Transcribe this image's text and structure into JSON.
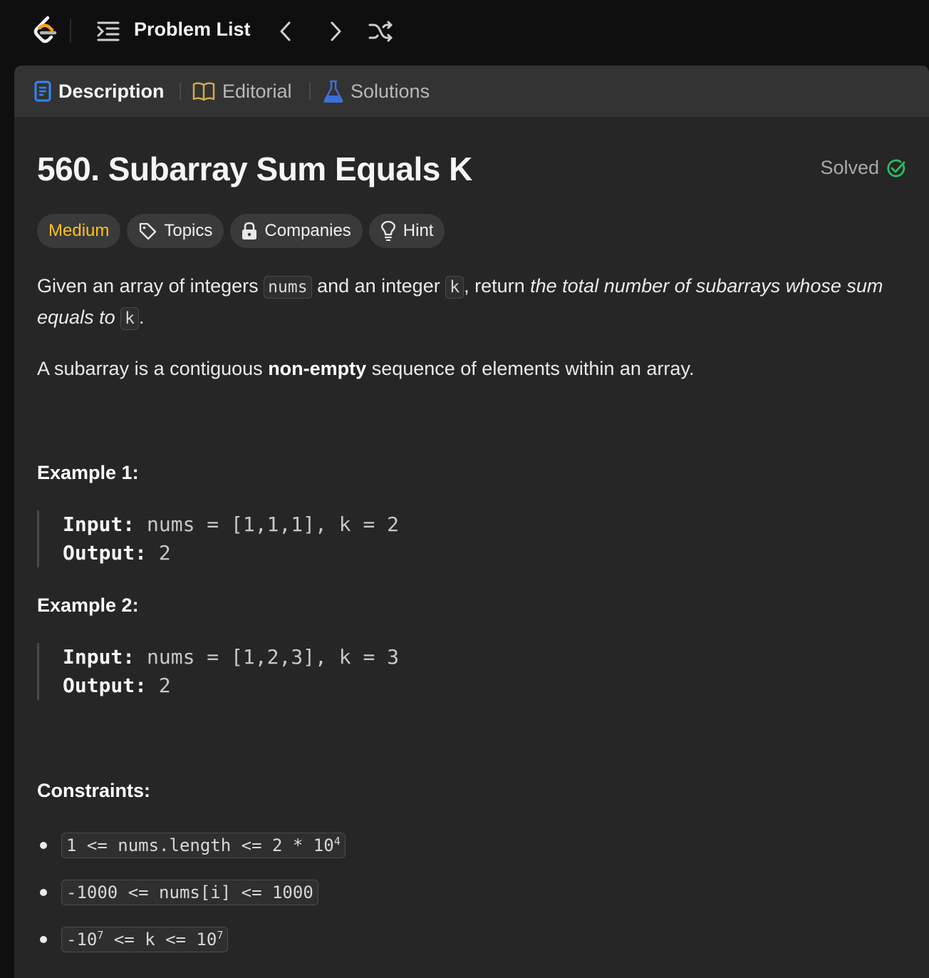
{
  "nav": {
    "problem_list_label": "Problem List"
  },
  "tabs": {
    "description": "Description",
    "editorial": "Editorial",
    "solutions": "Solutions"
  },
  "problem": {
    "title": "560. Subarray Sum Equals K",
    "status": "Solved",
    "difficulty": "Medium",
    "chips": {
      "topics": "Topics",
      "companies": "Companies",
      "hint": "Hint"
    },
    "description": {
      "p1_a": "Given an array of integers ",
      "p1_code1": "nums",
      "p1_b": " and an integer ",
      "p1_code2": "k",
      "p1_c": ", return ",
      "p1_em": "the total number of subarrays whose sum equals to",
      "p1_d": " ",
      "p1_code3": "k",
      "p1_e": ".",
      "p2_a": "A subarray is a contiguous ",
      "p2_bold": "non-empty",
      "p2_b": " sequence of elements within an array."
    },
    "examples": [
      {
        "heading": "Example 1:",
        "input_label": "Input:",
        "input_value": " nums = [1,1,1], k = 2",
        "output_label": "Output:",
        "output_value": " 2"
      },
      {
        "heading": "Example 2:",
        "input_label": "Input:",
        "input_value": " nums = [1,2,3], k = 3",
        "output_label": "Output:",
        "output_value": " 2"
      }
    ],
    "constraints_heading": "Constraints:",
    "constraints": [
      {
        "text": "1 <= nums.length <= 2 * 10",
        "sup": "4",
        "tail": ""
      },
      {
        "text": "-1000 <= nums[i] <= 1000",
        "sup": "",
        "tail": ""
      },
      {
        "text": "-10",
        "sup": "7",
        "tail": " <= k <= 10",
        "sup2": "7"
      }
    ]
  },
  "colors": {
    "background": "#0f0f0f",
    "panel": "#262626",
    "tabbar": "#333333",
    "medium": "#ffc01e",
    "solved_check": "#2cbb5d",
    "description_icon": "#2f88ff",
    "editorial_icon": "#d4a74a",
    "solutions_icon": "#3d6fd6"
  },
  "icons": {
    "logo": "leetcode-logo-icon",
    "problem_list": "list-icon",
    "prev": "chevron-left-icon",
    "next": "chevron-right-icon",
    "random": "shuffle-icon",
    "description": "document-icon",
    "editorial": "book-icon",
    "solutions": "flask-icon",
    "solved": "check-circle-icon",
    "topics": "tag-icon",
    "companies": "lock-icon",
    "hint": "lightbulb-icon"
  }
}
